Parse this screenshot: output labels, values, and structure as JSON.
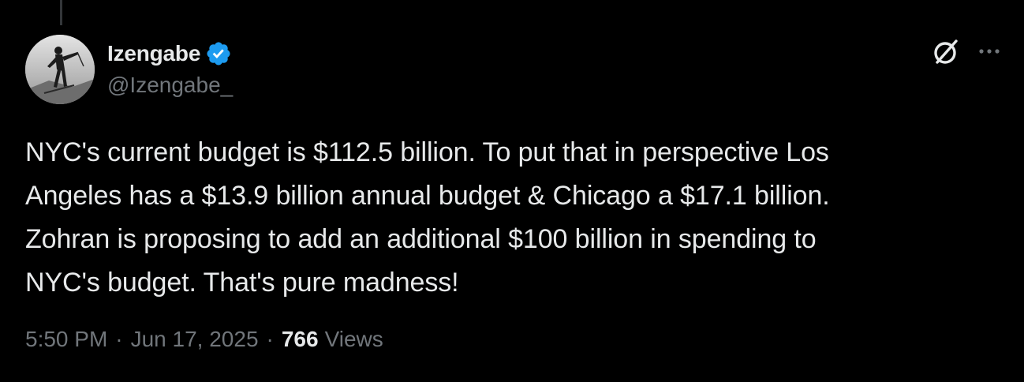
{
  "author": {
    "display_name": "Izengabe",
    "handle": "@Izengabe_",
    "verified": true,
    "avatar_icon": "avatar-photo",
    "verified_color": "#1d9bf0"
  },
  "actions": {
    "grok_icon": "grok-icon",
    "more_icon": "more-icon"
  },
  "tweet": {
    "text": "NYC's current budget is $112.5 billion. To put that in perspective Los\nAngeles has a $13.9 billion annual budget & Chicago a $17.1 billion.\nZohran is proposing to add an additional $100 billion in spending to\nNYC's budget. That's pure madness!"
  },
  "meta": {
    "time": "5:50 PM",
    "separator": "·",
    "date": "Jun 17, 2025",
    "views_count": "766",
    "views_label": "Views"
  },
  "colors": {
    "background": "#000000",
    "primary_text": "#e7e9ea",
    "secondary_text": "#71767b"
  }
}
